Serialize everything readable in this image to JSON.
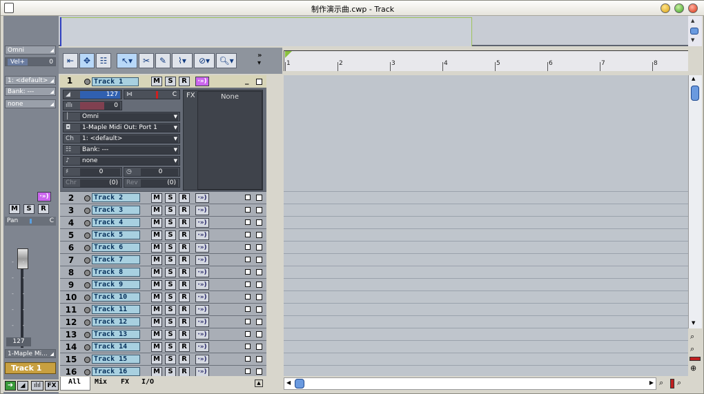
{
  "window": {
    "title": "制作演示曲.cwp - Track"
  },
  "left_panel": {
    "input": "Omni",
    "vel_label": "Vel+",
    "vel_value": "0",
    "patch": "1: <default>",
    "bank": "Bank: ---",
    "program": "none",
    "mute": "M",
    "solo": "S",
    "rec": "R",
    "pan_label": "Pan",
    "pan_value": "C",
    "volume": "127",
    "output": "1-Maple Mi...",
    "track_name": "Track 1"
  },
  "ruler": {
    "marks": [
      "1",
      "2",
      "3",
      "4",
      "5",
      "6",
      "7",
      "8"
    ]
  },
  "track1": {
    "number": "1",
    "name": "Track 1",
    "volume": "127",
    "pan": "C",
    "velocity": "0",
    "input": "Omni",
    "output": "1-Maple Midi Out: Port 1",
    "channel_label": "Ch",
    "channel": "1: <default>",
    "bank": "Bank: ---",
    "program": "none",
    "key_offset": "0",
    "time_offset": "0",
    "chorus_label": "Chr",
    "chorus": "(0)",
    "reverb_label": "Rev",
    "reverb": "(0)",
    "fx_label": "FX",
    "fx_value": "None"
  },
  "buttons": {
    "mute": "M",
    "solo": "S",
    "rec": "R",
    "input_echo": "·»)"
  },
  "tracks": [
    {
      "number": "2",
      "name": "Track 2"
    },
    {
      "number": "3",
      "name": "Track 3"
    },
    {
      "number": "4",
      "name": "Track 4"
    },
    {
      "number": "5",
      "name": "Track 5"
    },
    {
      "number": "6",
      "name": "Track 6"
    },
    {
      "number": "7",
      "name": "Track 7"
    },
    {
      "number": "8",
      "name": "Track 8"
    },
    {
      "number": "9",
      "name": "Track 9"
    },
    {
      "number": "10",
      "name": "Track 10"
    },
    {
      "number": "11",
      "name": "Track 11"
    },
    {
      "number": "12",
      "name": "Track 12"
    },
    {
      "number": "13",
      "name": "Track 13"
    },
    {
      "number": "14",
      "name": "Track 14"
    },
    {
      "number": "15",
      "name": "Track 15"
    },
    {
      "number": "16",
      "name": "Track 16"
    }
  ],
  "tabs": [
    "All",
    "Mix",
    "FX",
    "I/O"
  ],
  "colors": {
    "accent_purple": "#cc66ee",
    "track_name_bg": "#a8d0e0",
    "panel_bg": "#7f8590"
  }
}
